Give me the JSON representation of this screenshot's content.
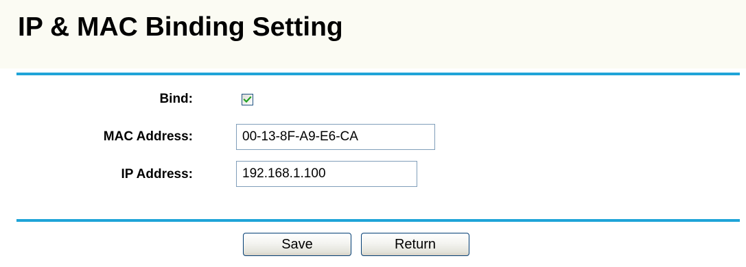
{
  "page": {
    "title": "IP & MAC Binding Setting"
  },
  "form": {
    "bind": {
      "label": "Bind:",
      "checked": true
    },
    "mac_address": {
      "label": "MAC Address:",
      "value": "00-13-8F-A9-E6-CA"
    },
    "ip_address": {
      "label": "IP Address:",
      "value": "192.168.1.100"
    }
  },
  "buttons": {
    "save_label": "Save",
    "return_label": "Return"
  },
  "colors": {
    "divider": "#1fa4d8",
    "title_background": "#fbfbf3",
    "checkmark": "#21a121"
  },
  "icons": {
    "checkbox_mark": "checkmark-icon"
  }
}
